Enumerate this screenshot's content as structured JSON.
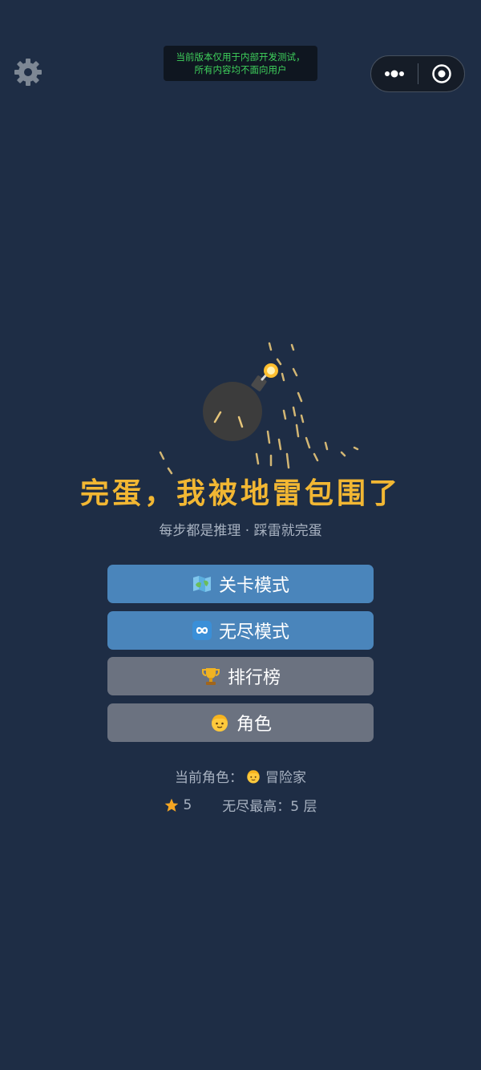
{
  "dev_notice": {
    "line1": "当前版本仅用于内部开发测试，",
    "line2": "所有内容均不面向用户"
  },
  "game": {
    "title": "完蛋，我被地雷包围了",
    "subtitle": "每步都是推理 · 踩雷就完蛋"
  },
  "menu": [
    {
      "label": "关卡模式",
      "icon": "map-icon"
    },
    {
      "label": "无尽模式",
      "icon": "infinity-icon"
    },
    {
      "label": "排行榜",
      "icon": "trophy-icon"
    },
    {
      "label": "角色",
      "icon": "person-icon"
    }
  ],
  "footer": {
    "current_role_label": "当前角色：",
    "current_role_name": "冒险家",
    "stars": "5",
    "endless_best": "无尽最高：5 层"
  },
  "colors": {
    "background": "#1e2d45",
    "title": "#f2b733",
    "primary_button": "#4a85bb",
    "secondary_button": "#6b7280"
  }
}
